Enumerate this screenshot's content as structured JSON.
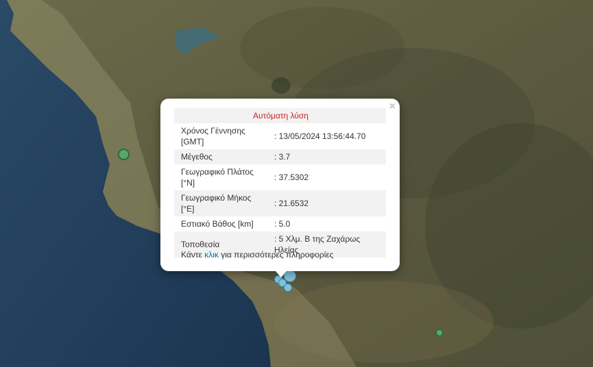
{
  "popup": {
    "close_icon": "×",
    "title": "Αυτόματη λύση",
    "rows": [
      {
        "label": "Χρόνος Γέννησης [GMT]",
        "value": ": 13/05/2024 13:56:44.70"
      },
      {
        "label": "Μέγεθος",
        "value": ": 3.7"
      },
      {
        "label": "Γεωγραφικό Πλάτος [°N]",
        "value": ": 37.5302"
      },
      {
        "label": "Γεωγραφικό Μήκος [°E]",
        "value": ": 21.6532"
      },
      {
        "label": "Εστιακό Βάθος [km]",
        "value": ": 5.0"
      },
      {
        "label": "Τοποθεσία",
        "value": ": 5 Χλμ. Β της Ζαχάρως Ηλείας"
      }
    ],
    "more_prefix": "Κάντε ",
    "more_link": "κλικ",
    "more_suffix": " για περισσότερες πληροφορίες"
  },
  "markers": [
    {
      "name": "earthquake-marker-green",
      "color": "#5aa66b"
    },
    {
      "name": "earthquake-marker-blue",
      "color": "#7fc3dd"
    }
  ],
  "colors": {
    "sea": "#1f3a55",
    "land": "#5a5a3f",
    "title_red": "#cc1f1f",
    "link": "#0078a8"
  }
}
